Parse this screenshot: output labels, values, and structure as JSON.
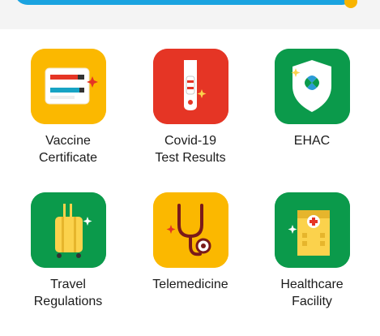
{
  "menu": {
    "items": [
      {
        "id": "vaccine",
        "label_lines": [
          "Vaccine",
          "Certificate"
        ],
        "icon": "vaccine-certificate-icon",
        "bg": "#fbb800"
      },
      {
        "id": "covid",
        "label_lines": [
          "Covid-19",
          "Test Results"
        ],
        "icon": "covid-test-icon",
        "bg": "#e53525"
      },
      {
        "id": "ehac",
        "label_lines": [
          "EHAC",
          ""
        ],
        "icon": "ehac-shield-icon",
        "bg": "#0b9a4b"
      },
      {
        "id": "travel",
        "label_lines": [
          "Travel",
          "Regulations"
        ],
        "icon": "luggage-icon",
        "bg": "#0b9a4b"
      },
      {
        "id": "tele",
        "label_lines": [
          "Telemedicine",
          ""
        ],
        "icon": "stethoscope-icon",
        "bg": "#fbb800"
      },
      {
        "id": "facility",
        "label_lines": [
          "Healthcare",
          "Facility"
        ],
        "icon": "hospital-building-icon",
        "bg": "#0b9a4b"
      }
    ]
  },
  "colors": {
    "banner": "#1aa3e0",
    "accent_yellow": "#f8b400",
    "red": "#e53525",
    "green": "#0b9a4b"
  }
}
